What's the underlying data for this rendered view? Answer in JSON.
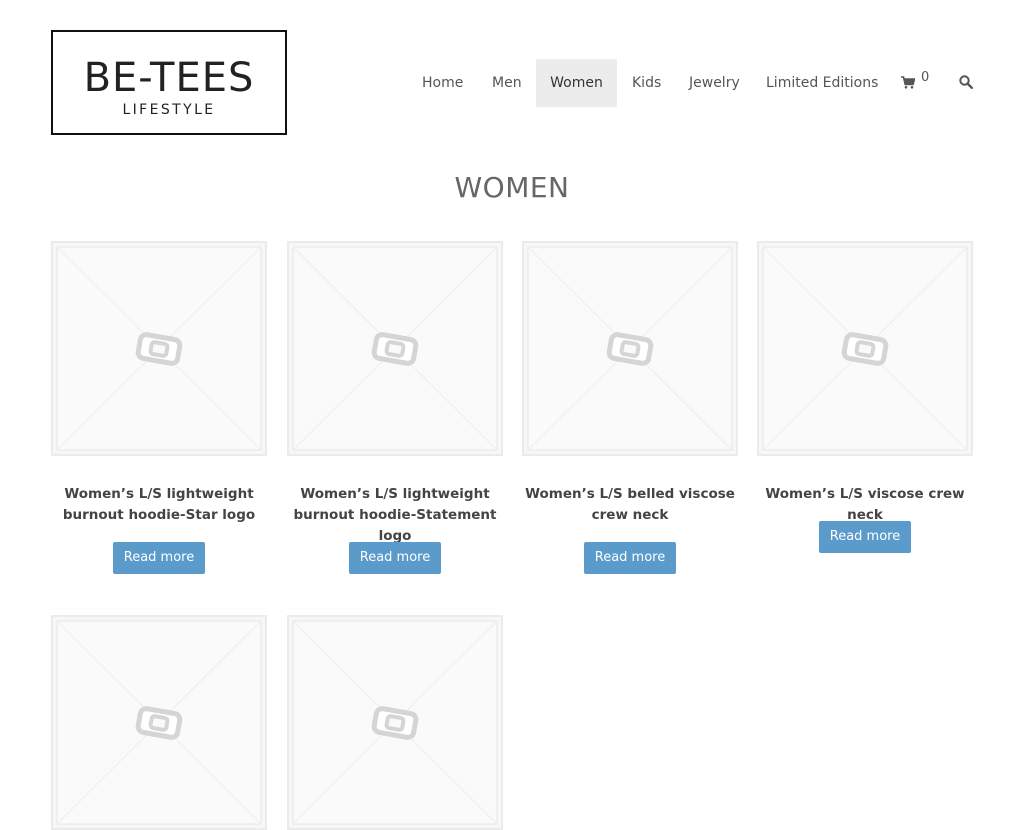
{
  "logo": {
    "main": "BE-TEES",
    "sub": "LIFESTYLE"
  },
  "nav": [
    {
      "label": "Home",
      "active": false
    },
    {
      "label": "Men",
      "active": false
    },
    {
      "label": "Women",
      "active": true
    },
    {
      "label": "Kids",
      "active": false
    },
    {
      "label": "Jewelry",
      "active": false
    },
    {
      "label": "Limited Editions",
      "active": false
    }
  ],
  "cart": {
    "count": "0",
    "icon": "shopping-cart-icon"
  },
  "search": {
    "icon": "search-icon"
  },
  "page": {
    "title": "WOMEN"
  },
  "colors": {
    "button": "#5b9bcb",
    "active_nav_bg": "#ececec",
    "thumb_border": "#ebebeb"
  },
  "products": [
    {
      "title": "Women’s L/S lightweight burnout hoodie-Star logo",
      "button": "Read more"
    },
    {
      "title": "Women’s L/S lightweight burnout hoodie-Statement logo",
      "button": "Read more"
    },
    {
      "title": "Women’s L/S belled viscose crew neck",
      "button": "Read more"
    },
    {
      "title": "Women’s L/S viscose crew neck",
      "button": "Read more"
    },
    {
      "title": "",
      "button": ""
    },
    {
      "title": "",
      "button": ""
    }
  ]
}
